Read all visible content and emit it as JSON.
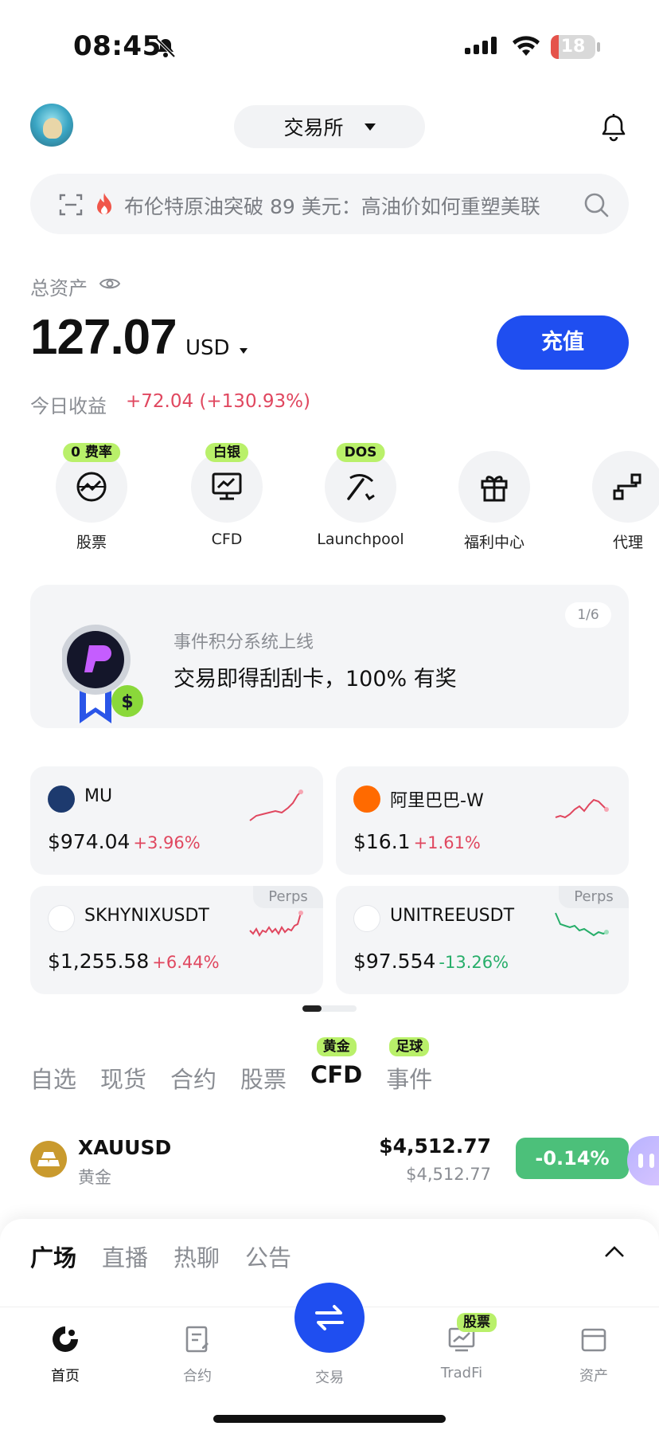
{
  "status": {
    "time": "08:45",
    "battery": "18",
    "battery_level": 0.18
  },
  "header": {
    "exchange_label": "交易所"
  },
  "search": {
    "text": "布伦特原油突破 89 美元：高油价如何重塑美联"
  },
  "assets": {
    "label": "总资产",
    "value": "127.07",
    "currency": "USD",
    "deposit_label": "充值",
    "today_label": "今日收益",
    "today_value": "+72.04 (+130.93%)"
  },
  "quick_menu": [
    {
      "label": "股票",
      "badge": "0 费率",
      "icon": "globe-chart-icon"
    },
    {
      "label": "CFD",
      "badge": "白银",
      "icon": "monitor-chart-icon"
    },
    {
      "label": "Launchpool",
      "badge": "DOS",
      "icon": "pickaxe-icon"
    },
    {
      "label": "福利中心",
      "badge": "",
      "icon": "gift-icon"
    },
    {
      "label": "代理",
      "badge": "",
      "icon": "network-icon"
    }
  ],
  "promo": {
    "page": "1/6",
    "subtitle": "事件积分系统上线",
    "title": "交易即得刮刮卡，100% 有奖"
  },
  "tickers": [
    {
      "name": "MU",
      "price": "$974.04",
      "change": "+3.96%",
      "direction": "up",
      "perps": "",
      "logo_color": "#1d3a6e"
    },
    {
      "name": "阿里巴巴-W",
      "price": "$16.1",
      "change": "+1.61%",
      "direction": "up",
      "perps": "",
      "logo_color": "#ff6a00"
    },
    {
      "name": "SKHYNIXUSDT",
      "price": "$1,255.58",
      "change": "+6.44%",
      "direction": "up",
      "perps": "Perps",
      "logo_color": "#ffffff"
    },
    {
      "name": "UNITREEUSDT",
      "price": "$97.554",
      "change": "-13.26%",
      "direction": "down",
      "perps": "Perps",
      "logo_color": "#ffffff"
    }
  ],
  "market_tabs": [
    {
      "label": "自选",
      "badge": ""
    },
    {
      "label": "现货",
      "badge": ""
    },
    {
      "label": "合约",
      "badge": ""
    },
    {
      "label": "股票",
      "badge": ""
    },
    {
      "label": "CFD",
      "badge": "黄金",
      "active": true
    },
    {
      "label": "事件",
      "badge": "足球"
    }
  ],
  "market_row": {
    "symbol": "XAUUSD",
    "name": "黄金",
    "last": "$4,512.77",
    "last_sub": "$4,512.77",
    "change": "-0.14%"
  },
  "sheet_tabs": [
    "广场",
    "直播",
    "热聊",
    "公告"
  ],
  "nav": {
    "home": "首页",
    "contract": "合约",
    "trade": "交易",
    "tradfi": "TradFi",
    "tradfi_badge": "股票",
    "assets": "资产"
  },
  "colors": {
    "accent": "#1f4ef0",
    "up": "#e0475f",
    "down": "#27ae6a",
    "badge": "#b9f06a"
  }
}
